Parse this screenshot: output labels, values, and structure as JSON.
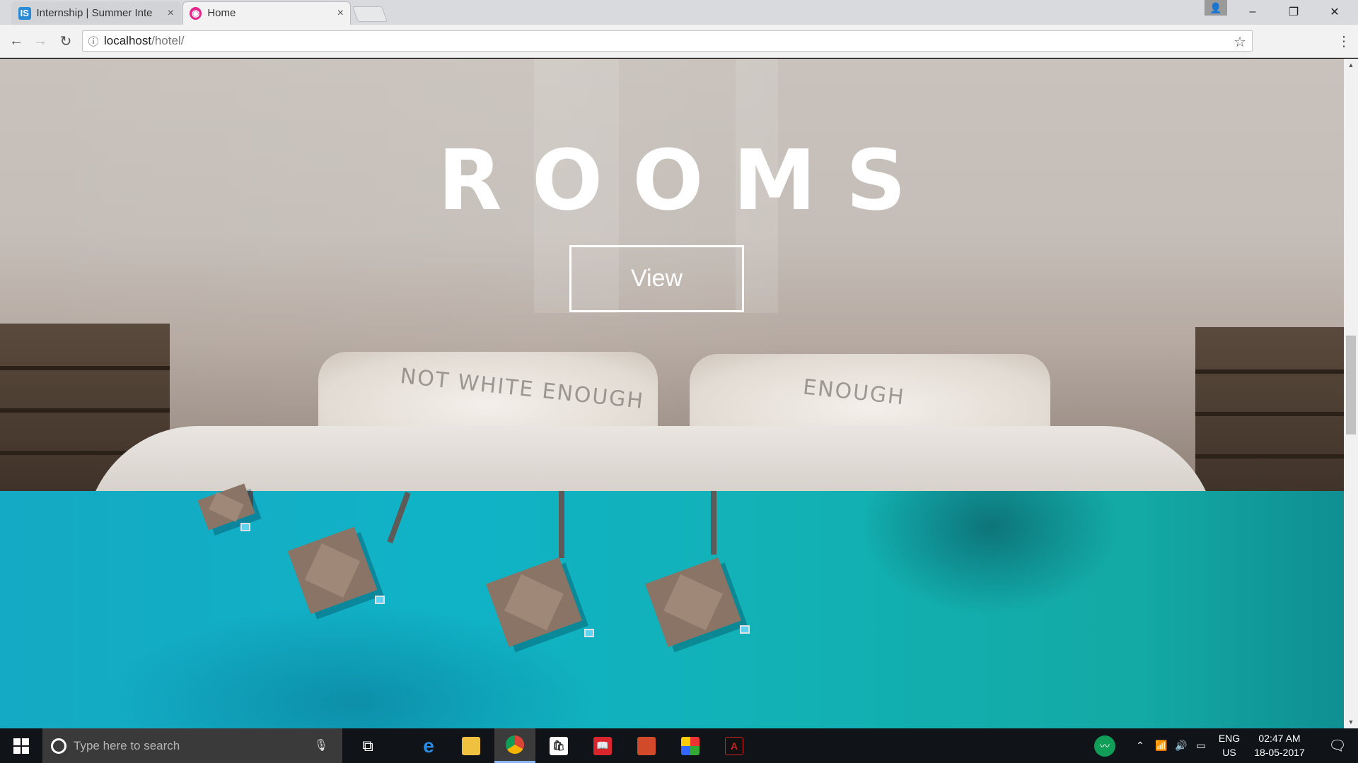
{
  "browser": {
    "tabs": [
      {
        "title": "Internship | Summer Inte",
        "favicon": "is-logo-icon",
        "active": false
      },
      {
        "title": "Home",
        "favicon": "site-logo-icon",
        "active": true
      }
    ],
    "tab_close_glyph": "×",
    "url_host": "localhost",
    "url_path": "/hotel/",
    "window_controls": {
      "minimize": "–",
      "restore": "❐",
      "close": "✕"
    }
  },
  "page": {
    "rooms_heading": "ROOMS",
    "view_button_label": "View",
    "pillow_left_text": "NOT WHITE ENOUGH",
    "pillow_right_text": "ENOUGH"
  },
  "taskbar": {
    "search_placeholder": "Type here to search",
    "language": "ENG",
    "region": "US",
    "time": "02:47 AM",
    "date": "18-05-2017"
  },
  "colors": {
    "accent_active_tab": "#8ab4f8",
    "sea": "#12b1b4",
    "taskbar": "#101418"
  }
}
